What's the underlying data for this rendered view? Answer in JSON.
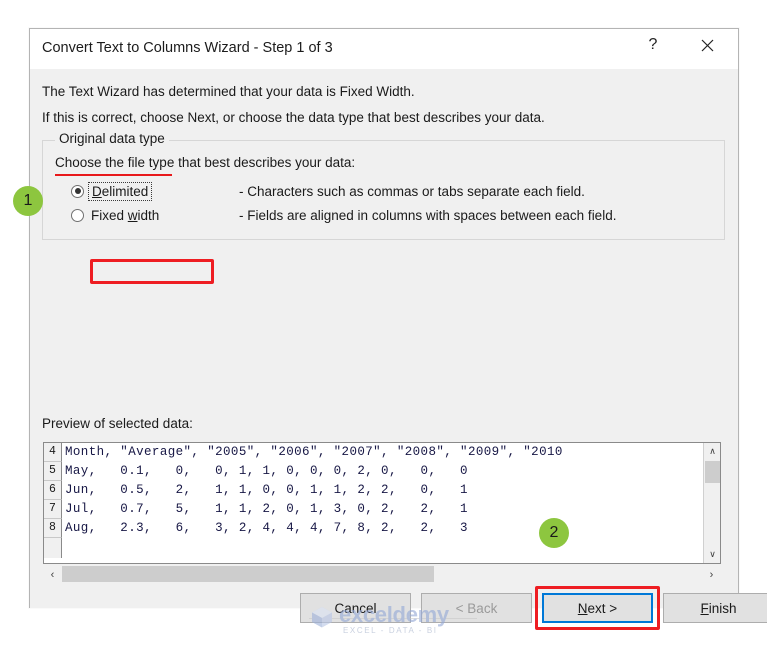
{
  "window": {
    "title": "Convert Text to Columns Wizard - Step 1 of 3",
    "help_label": "?",
    "close_label": "✕"
  },
  "description": {
    "line1": "The Text Wizard has determined that your data is Fixed Width.",
    "line2": "If this is correct, choose Next, or choose the data type that best describes your data."
  },
  "original_data_type": {
    "group_label": "Original data type",
    "instruction": "Choose the file type that best describes your data:",
    "options": [
      {
        "label": "Delimited",
        "accel": "D",
        "description": "- Characters such as commas or tabs separate each field.",
        "selected": true
      },
      {
        "label": "Fixed width",
        "accel": "w",
        "description": "- Fields are aligned in columns with spaces between each field.",
        "selected": false
      }
    ]
  },
  "preview": {
    "label": "Preview of selected data:",
    "rows": [
      {
        "num": "4",
        "text": "Month, \"Average\", \"2005\", \"2006\", \"2007\", \"2008\", \"2009\", \"2010"
      },
      {
        "num": "5",
        "text": "May,   0.1,   0,   0, 1, 1, 0, 0, 0, 2, 0,   0,   0"
      },
      {
        "num": "6",
        "text": "Jun,   0.5,   2,   1, 1, 0, 0, 1, 1, 2, 2,   0,   1"
      },
      {
        "num": "7",
        "text": "Jul,   0.7,   5,   1, 1, 2, 0, 1, 3, 0, 2,   2,   1"
      },
      {
        "num": "8",
        "text": "Aug,   2.3,   6,   3, 2, 4, 4, 4, 7, 8, 2,   2,   3"
      }
    ],
    "vscroll": {
      "up": "∧",
      "down": "∨"
    },
    "hscroll": {
      "left": "‹",
      "right": "›"
    }
  },
  "footer": {
    "cancel": "Cancel",
    "back": "< Back",
    "next_prefix": "N",
    "next_rest": "ext >",
    "finish_prefix": "F",
    "finish_rest": "inish"
  },
  "annotations": {
    "badge1": "1",
    "badge2": "2",
    "accent_red": "#ee1d22",
    "accent_green": "#8dc63f",
    "focus_blue": "#0078d7"
  },
  "watermark": {
    "name": "exceldemy",
    "tagline": "EXCEL - DATA - BI"
  }
}
